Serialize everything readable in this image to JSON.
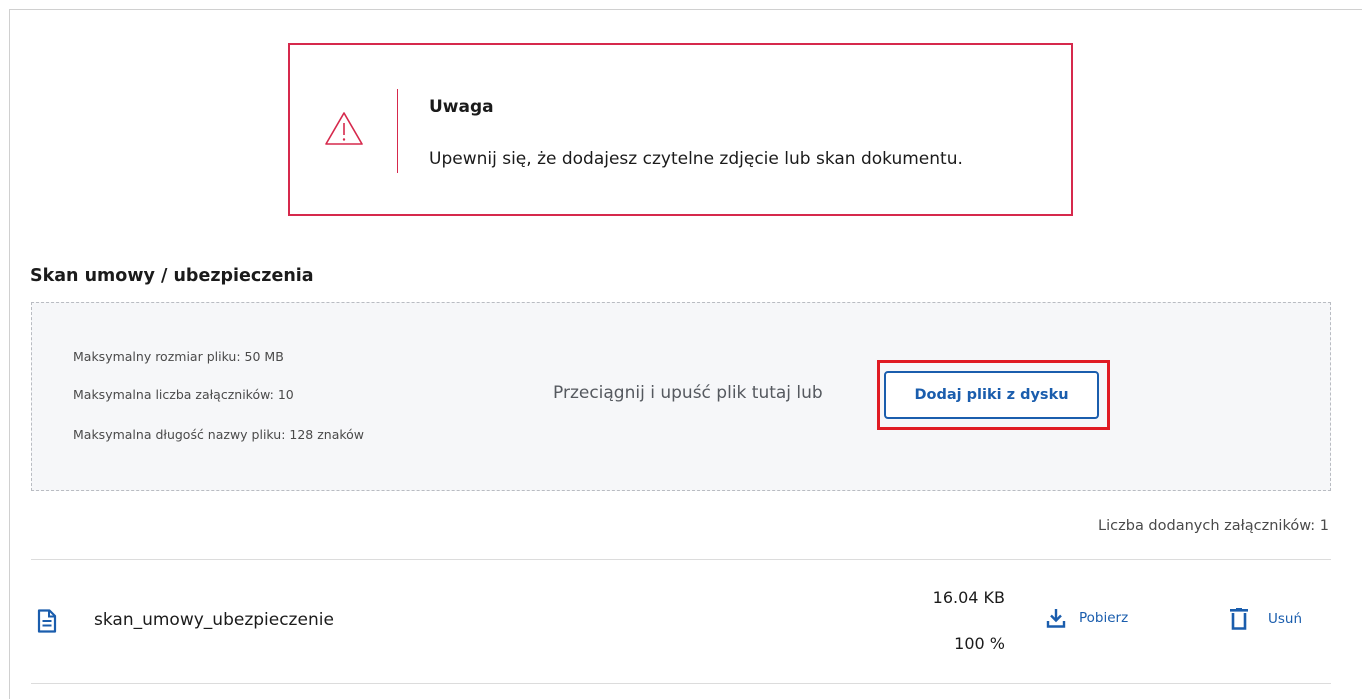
{
  "alert": {
    "icon": "warning-triangle-icon",
    "title": "Uwaga",
    "message": "Upewnij się, że dodajesz czytelne zdjęcie lub skan dokumentu.",
    "color": "#d6294c"
  },
  "section": {
    "title": "Skan umowy / ubezpieczenia"
  },
  "dropzone": {
    "limits": [
      "Maksymalny rozmiar pliku: 50 MB",
      "Maksymalna liczba załączników: 10",
      "Maksymalna długość nazwy pliku: 128 znaków"
    ],
    "drop_text": "Przeciągnij i upuść plik tutaj lub",
    "add_button_label": "Dodaj pliki z dysku"
  },
  "attachments": {
    "count_text": "Liczba dodanych załączników: 1",
    "files": [
      {
        "icon": "document-icon",
        "name": "skan_umowy_ubezpieczenie",
        "size": "16.04 KB",
        "progress": "100 %",
        "download_icon": "download-icon",
        "download_label": "Pobierz",
        "delete_icon": "trash-icon",
        "delete_label": "Usuń"
      }
    ]
  },
  "colors": {
    "accent": "#1a5dad",
    "highlight": "#e01b24"
  }
}
